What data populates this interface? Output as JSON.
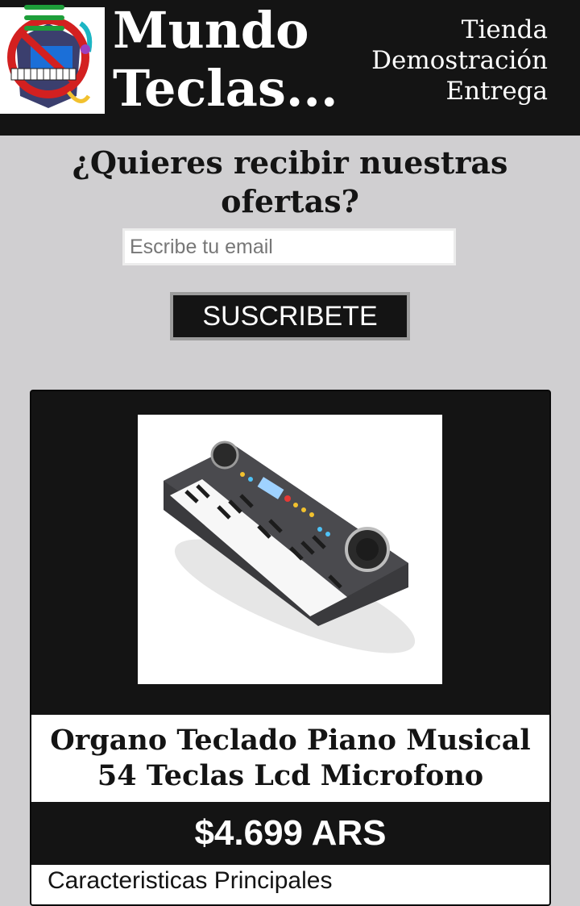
{
  "header": {
    "brand_line1": "Mundo",
    "brand_line2": "Teclas...",
    "nav": [
      "Tienda",
      "Demostración",
      "Entrega"
    ],
    "menu_icon": "hamburger-menu-icon",
    "accent_color": "#1e9e3a"
  },
  "newsletter": {
    "title": "¿Quieres recibir nuestras ofertas?",
    "email_placeholder": "Escribe tu email",
    "email_value": "",
    "button_label": "SUSCRIBETE"
  },
  "product": {
    "title": "Organo Teclado Piano Musical 54 Teclas Lcd Microfono",
    "price": "$4.699 ARS",
    "features_heading": "Caracteristicas Principales"
  },
  "colors": {
    "header_bg": "#141414",
    "page_bg": "#d0cfd1",
    "text": "#141414",
    "card_bg": "#141414"
  }
}
